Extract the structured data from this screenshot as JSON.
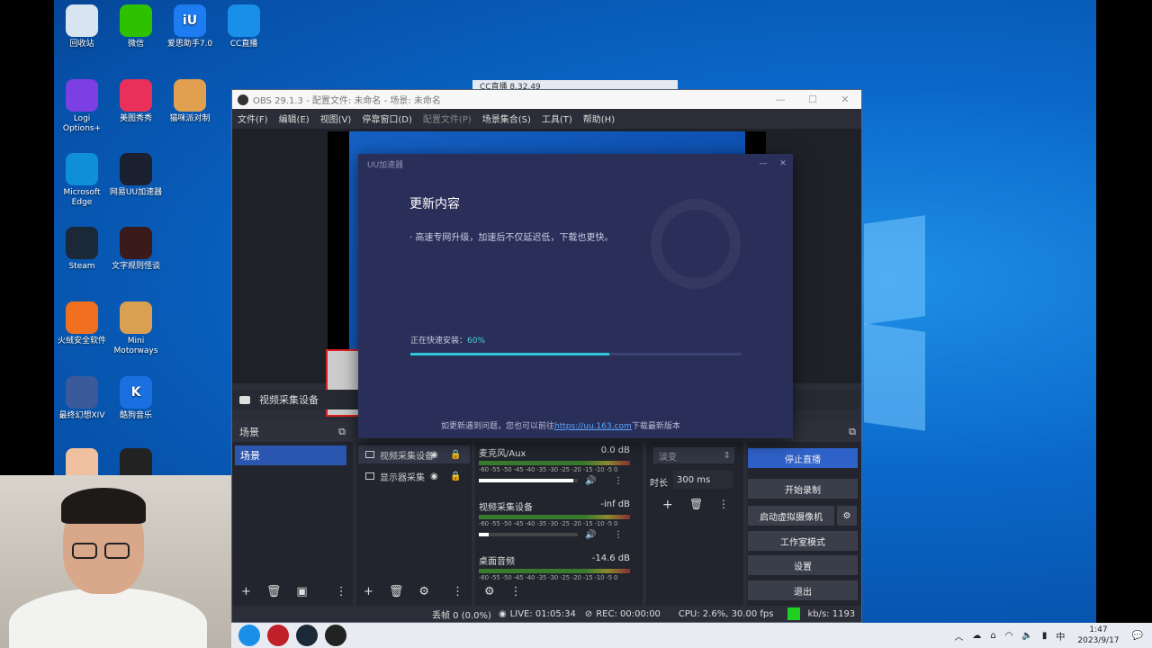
{
  "desktop_icons": [
    {
      "label": "回收站",
      "icon": "recycle-bin-icon",
      "color": "#d8e4f0"
    },
    {
      "label": "微信",
      "icon": "wechat-icon",
      "color": "#2dc100"
    },
    {
      "label": "爱思助手7.0",
      "icon": "i4-icon",
      "color": "#1d7cf2",
      "glyph": "iU"
    },
    {
      "label": "CC直播",
      "icon": "cc-live-icon",
      "color": "#1a8fe8"
    },
    {
      "label": "Logi Options+",
      "icon": "logi-icon",
      "color": "#7b3fe4"
    },
    {
      "label": "美图秀秀",
      "icon": "meitu-icon",
      "color": "#e8305a"
    },
    {
      "label": "猫咪派对制",
      "icon": "dog-icon",
      "color": "#e0a050"
    },
    {
      "label": "Microsoft Edge",
      "icon": "edge-icon",
      "color": "#0f8fd8"
    },
    {
      "label": "网易UU加速器",
      "icon": "uu-icon",
      "color": "#1a2030"
    },
    {
      "label": "Steam",
      "icon": "steam-icon",
      "color": "#1b2838"
    },
    {
      "label": "文字规则怪谈",
      "icon": "game-icon",
      "color": "#3a1a1a"
    },
    {
      "label": "火绒安全软件",
      "icon": "huorong-icon",
      "color": "#f07020"
    },
    {
      "label": "Mini Motorways",
      "icon": "map-pin-icon",
      "color": "#d8a050"
    },
    {
      "label": "最终幻想XIV",
      "icon": "ff14-icon",
      "color": "#3a5a9a"
    },
    {
      "label": "酷狗音乐",
      "icon": "kugou-icon",
      "color": "#1a70e0",
      "glyph": "K"
    },
    {
      "label": "",
      "icon": "anime-icon",
      "color": "#f0c0a0"
    },
    {
      "label": "",
      "icon": "obs-icon",
      "color": "#222222"
    }
  ],
  "cc_popup": {
    "title": "CC直播 8.32.49"
  },
  "obs": {
    "title": "OBS 29.1.3 - 配置文件: 未命名 - 场景: 未命名",
    "menu": [
      "文件(F)",
      "编辑(E)",
      "视图(V)",
      "停靠窗口(D)",
      "配置文件(P)",
      "场景集合(S)",
      "工具(T)",
      "帮助(H)"
    ],
    "source_bar_label": "视频采集设备",
    "scenes": {
      "title": "场景",
      "items": [
        "场景"
      ]
    },
    "sources": {
      "items": [
        "视频采集设备",
        "显示器采集"
      ]
    },
    "mixer": {
      "channels": [
        {
          "name": "麦克风/Aux",
          "level": "0.0 dB",
          "volume": 0.95
        },
        {
          "name": "视频采集设备",
          "level": "-inf dB",
          "volume": 0.1
        },
        {
          "name": "桌面音频",
          "level": "-14.6 dB",
          "volume": 0.6
        }
      ],
      "scale": "-60 -55 -50 -45 -40 -35 -30 -25 -20 -15 -10 -5 0"
    },
    "transitions": {
      "type": "淡变",
      "duration_label": "时长",
      "duration": "300 ms"
    },
    "controls": [
      "停止直播",
      "开始录制",
      "启动虚拟摄像机",
      "工作室模式",
      "设置",
      "退出"
    ],
    "status": {
      "dropped": "丢帧 0 (0.0%)",
      "live": "LIVE: 01:05:34",
      "rec": "REC: 00:00:00",
      "cpu": "CPU: 2.6%, 30.00 fps",
      "kbs": "kb/s: 1193"
    }
  },
  "uu_dialog": {
    "title": "UU加速器",
    "heading": "更新内容",
    "body": "· 高速专网升级，加速后不仅延迟低，下载也更快。",
    "progress_label": "正在快速安装：",
    "progress_pct": "60%",
    "progress": 0.6,
    "footer_prefix": "如更新遇到问题，您也可以前往",
    "footer_link": "https://uu.163.com",
    "footer_suffix": "下载最新版本"
  },
  "taskbar": {
    "apps": [
      {
        "icon": "cc-live-icon",
        "color": "#1a8fe8"
      },
      {
        "icon": "netease-icon",
        "color": "#c0202a"
      },
      {
        "icon": "steam-icon",
        "color": "#1b2838"
      },
      {
        "icon": "obs-icon",
        "color": "#222222"
      }
    ],
    "ime": "中",
    "time": "1:47",
    "date": "2023/9/17"
  }
}
